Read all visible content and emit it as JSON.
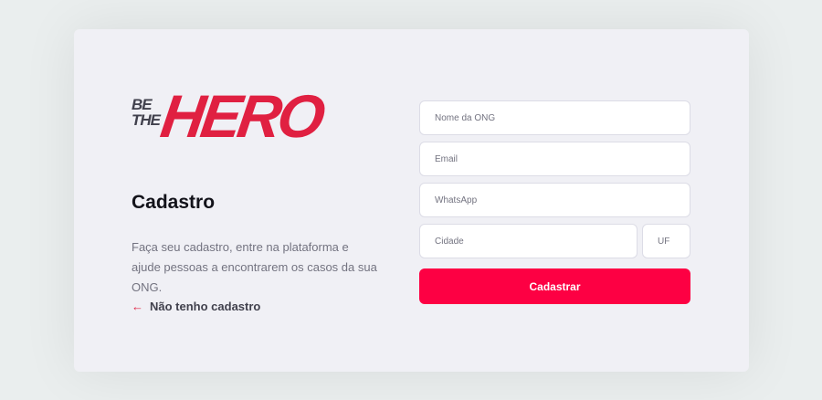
{
  "logo": {
    "line1": "BE",
    "line2": "THE",
    "brand": "HERO"
  },
  "page": {
    "title": "Cadastro",
    "description": "Faça seu cadastro, entre na plataforma e ajude pessoas a encontrarem os casos da sua ONG.",
    "back_link": {
      "icon": "arrow-left-icon",
      "label": "Não tenho cadastro"
    }
  },
  "form": {
    "nome": {
      "placeholder": "Nome da ONG",
      "value": ""
    },
    "email": {
      "placeholder": "Email",
      "value": ""
    },
    "whatsapp": {
      "placeholder": "WhatsApp",
      "value": ""
    },
    "cidade": {
      "placeholder": "Cidade",
      "value": ""
    },
    "uf": {
      "placeholder": "UF",
      "value": ""
    },
    "submit_label": "Cadastrar"
  },
  "colors": {
    "background": "#eaeeee",
    "card": "#f0f0f5",
    "accent": "#fd0043",
    "text_dark": "#13131a",
    "text_muted": "#737380"
  }
}
